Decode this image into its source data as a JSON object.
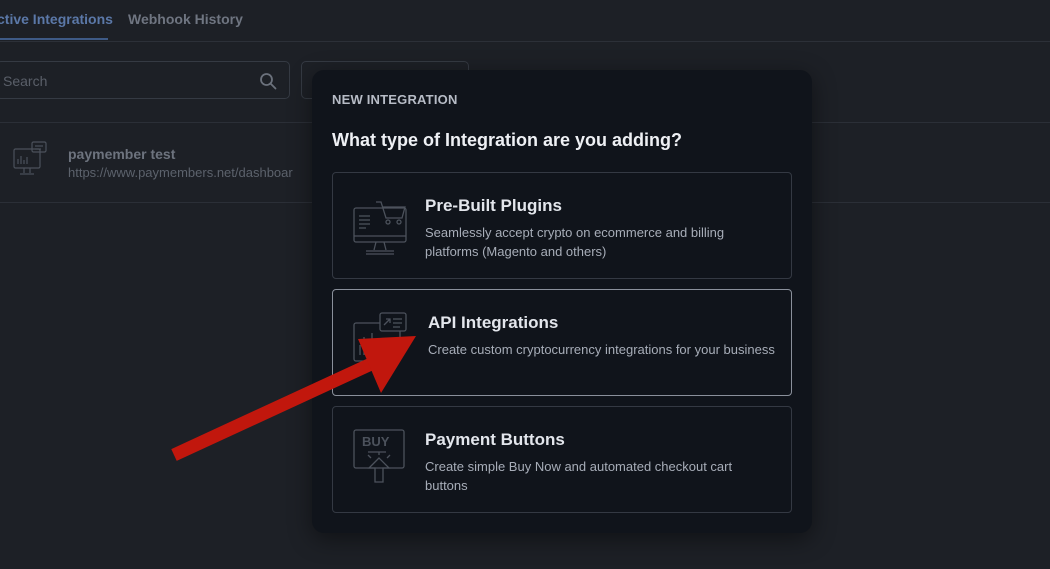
{
  "tabs": [
    {
      "label": "ctive Integrations",
      "active": true
    },
    {
      "label": "Webhook History",
      "active": false
    }
  ],
  "search": {
    "placeholder": "Search"
  },
  "integration_row": {
    "name": "paymember test",
    "url": "https://www.paymembers.net/dashboar"
  },
  "modal": {
    "kicker": "NEW INTEGRATION",
    "heading": "What type of Integration are you adding?",
    "options": [
      {
        "title": "Pre-Built Plugins",
        "description": "Seamlessly accept crypto on ecommerce and billing platforms (Magento and others)",
        "icon": "monitor-cart-icon"
      },
      {
        "title": "API Integrations",
        "description": "Create custom cryptocurrency integrations for your business",
        "icon": "api-monitor-icon",
        "highlighted": true
      },
      {
        "title": "Payment Buttons",
        "description": "Create simple Buy Now and automated checkout cart buttons",
        "icon": "buy-button-icon"
      }
    ]
  },
  "colors": {
    "background": "#1d2026",
    "modal": "#10141b",
    "annotation_arrow": "#c1170d"
  }
}
